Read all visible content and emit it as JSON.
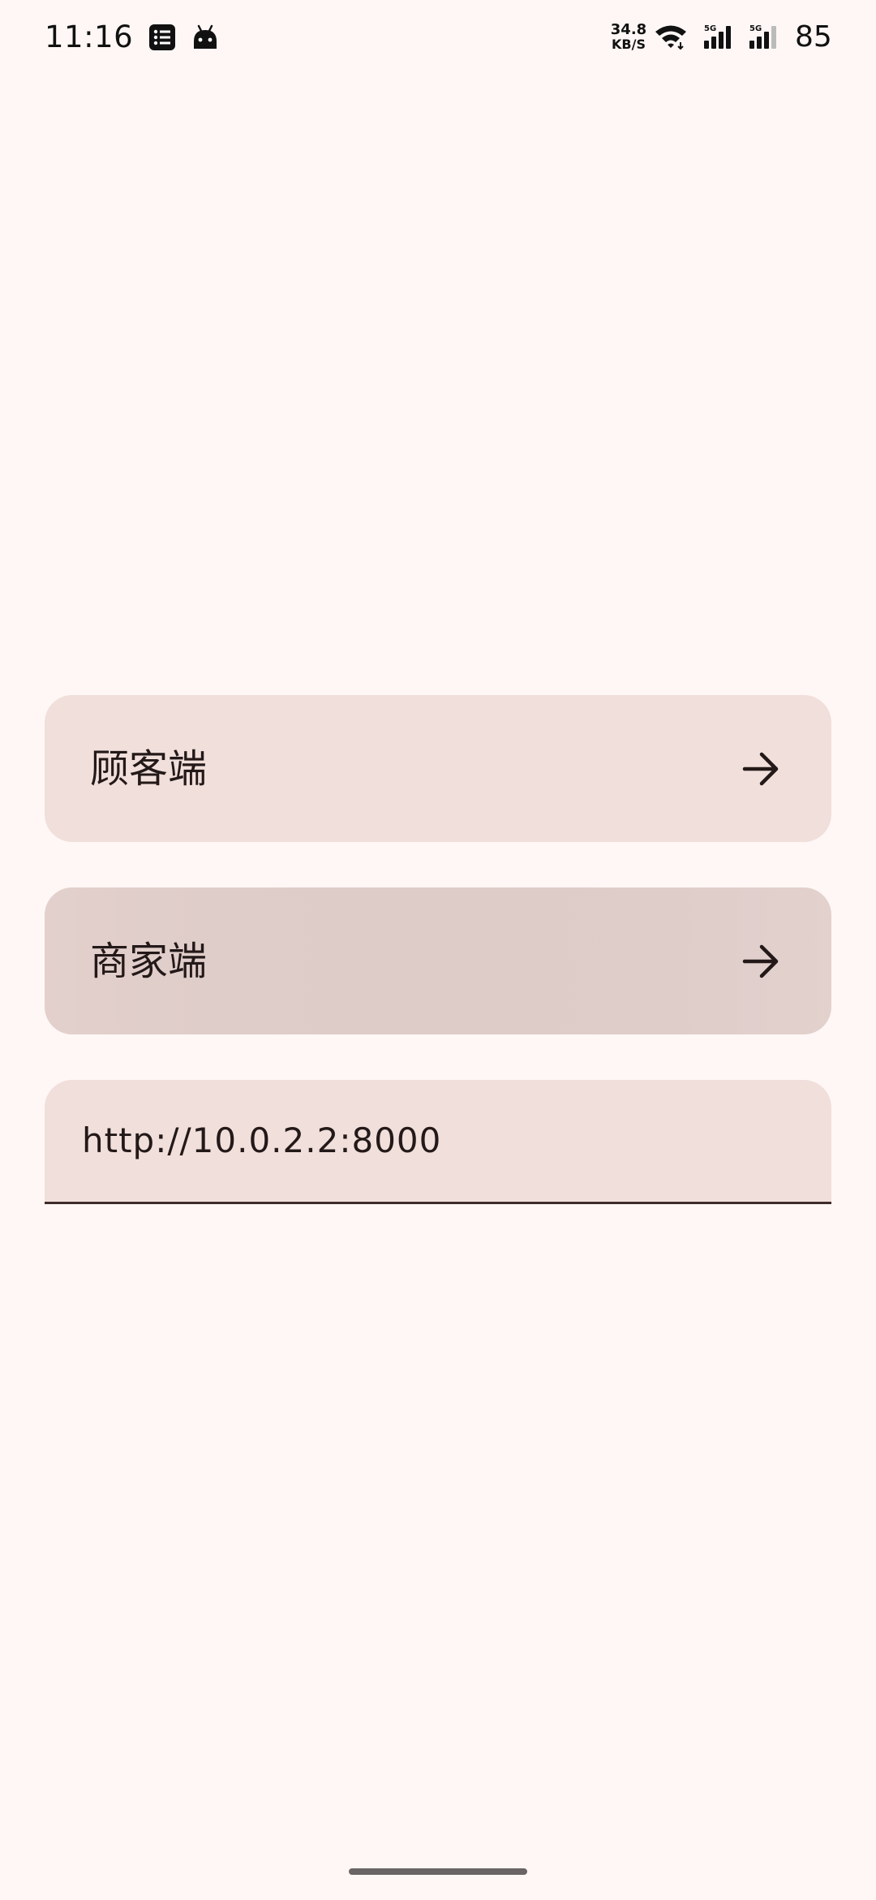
{
  "status_bar": {
    "time": "11:16",
    "net_speed_value": "34.8",
    "net_speed_unit": "KB/S",
    "signal_1_label": "5G",
    "signal_2_label": "5G",
    "battery": "85",
    "icons": [
      "list-notification-icon",
      "android-notification-icon",
      "wifi-icon",
      "signal-icon",
      "signal-icon"
    ]
  },
  "buttons": {
    "customer_label": "顾客端",
    "merchant_label": "商家端"
  },
  "server_field": {
    "value": "http://10.0.2.2:8000"
  },
  "colors": {
    "background": "#FFF7F5",
    "button_surface": "#F1DFDB",
    "button_pressed": "#DFCDCA",
    "on_surface": "#231918"
  }
}
